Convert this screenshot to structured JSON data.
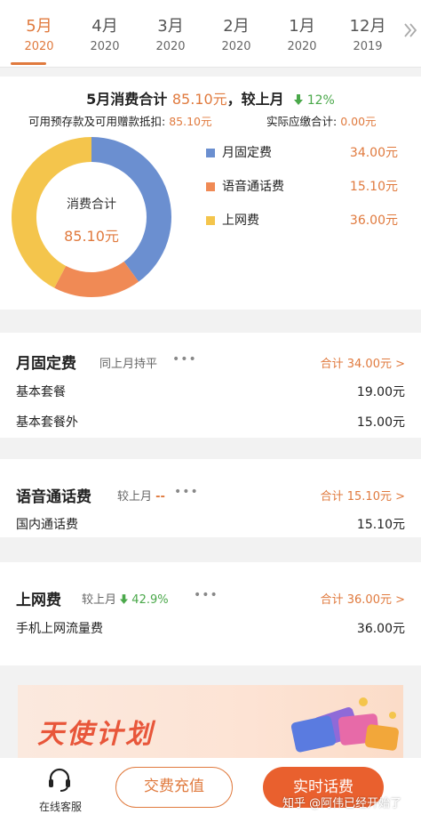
{
  "month_tabs": [
    {
      "month": "5月",
      "year": "2020"
    },
    {
      "month": "4月",
      "year": "2020"
    },
    {
      "month": "3月",
      "year": "2020"
    },
    {
      "month": "2月",
      "year": "2020"
    },
    {
      "month": "1月",
      "year": "2020"
    },
    {
      "month": "12月",
      "year": "2019"
    }
  ],
  "active_tab": 0,
  "more_tabs_icon": "chevron-double-right-icon",
  "summary": {
    "title_prefix": "5月消费合计",
    "title_amount": "85.10元",
    "title_compare": "，较上月",
    "change_icon": "arrow-down-icon",
    "change_value": "12%",
    "deduction_label": "可用预存款及可用赠款抵扣:",
    "deduction_value": "85.10元",
    "payable_label": "实际应缴合计:",
    "payable_value": "0.00元",
    "center_label": "消费合计",
    "center_value": "85.10元"
  },
  "legend": [
    {
      "name": "月固定费",
      "value": "34.00元",
      "color": "#6b8fd0"
    },
    {
      "name": "语音通话费",
      "value": "15.10元",
      "color": "#f08a55"
    },
    {
      "name": "上网费",
      "value": "36.00元",
      "color": "#f4c54c"
    }
  ],
  "sections": [
    {
      "title": "月固定费",
      "compare": "同上月持平",
      "compare_change": "",
      "more": "•••",
      "total": "合计 34.00元 >",
      "rows": [
        {
          "name": "基本套餐",
          "value": "19.00元"
        },
        {
          "name": "基本套餐外",
          "value": "15.00元"
        }
      ]
    },
    {
      "title": "语音通话费",
      "compare": "较上月",
      "compare_change": "--",
      "more": "•••",
      "total": "合计 15.10元 >",
      "rows": [
        {
          "name": "国内通话费",
          "value": "15.10元"
        }
      ]
    },
    {
      "title": "上网费",
      "compare": "较上月",
      "compare_change": "42.9%",
      "more": "•••",
      "total": "合计 36.00元 >",
      "rows": [
        {
          "name": "手机上网流量费",
          "value": "36.00元"
        }
      ]
    }
  ],
  "banner": {
    "title": "天使计划"
  },
  "bottom_bar": {
    "service_label": "在线客服",
    "service_icon": "headset-icon",
    "recharge_label": "交费充值",
    "realtime_label": "实时话费",
    "watermark": "知乎 @阿伟已经开始了"
  },
  "colors": {
    "accent": "#e07a3e",
    "down": "#4aa84a",
    "solid_button": "#e9602e"
  }
}
